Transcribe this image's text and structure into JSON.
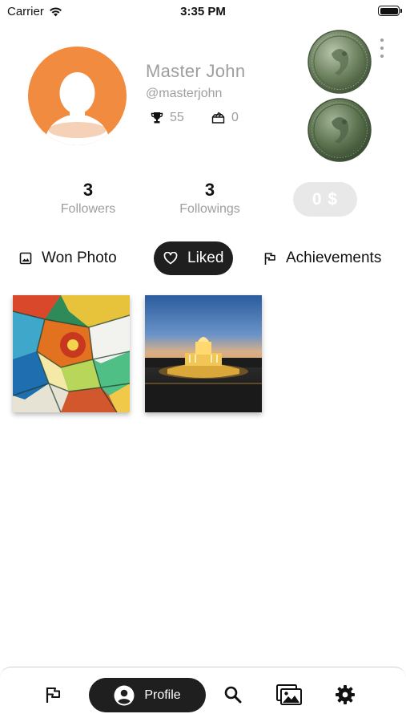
{
  "status_bar": {
    "carrier": "Carrier",
    "time": "3:35 PM"
  },
  "profile": {
    "name": "Master John",
    "handle": "@masterjohn",
    "trophies": "55",
    "votes": "0",
    "balance": "0 $"
  },
  "counts": {
    "followers": {
      "value": "3",
      "label": "Followers"
    },
    "followings": {
      "value": "3",
      "label": "Followings"
    }
  },
  "tabs": [
    {
      "label": "Won Photo",
      "icon": "image-icon",
      "active": false
    },
    {
      "label": "Liked",
      "icon": "heart-icon",
      "active": true
    },
    {
      "label": "Achievements",
      "icon": "flag-icon",
      "active": false
    }
  ],
  "photos": [
    {
      "kind": "mosaic-tiles"
    },
    {
      "kind": "fountain-at-night"
    }
  ],
  "bottom_nav": {
    "items": [
      "flag-icon",
      "profile",
      "search-icon",
      "gallery-icon",
      "gear-icon"
    ],
    "profile_label": "Profile"
  },
  "colors": {
    "accent_dark": "#1f1f1f",
    "avatar_orange": "#f08b3f",
    "muted_text": "#9e9e9e"
  }
}
